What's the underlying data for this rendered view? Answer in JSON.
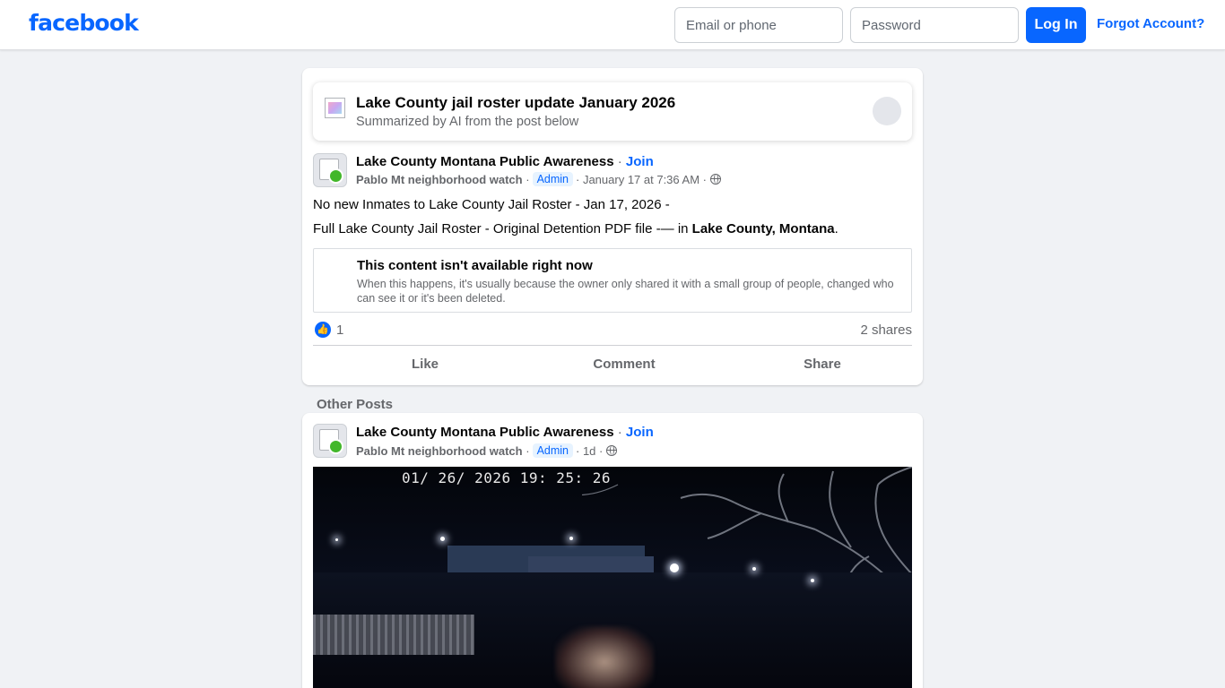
{
  "header": {
    "logo": "facebook",
    "email_placeholder": "Email or phone",
    "password_placeholder": "Password",
    "login_label": "Log In",
    "forgot_label": "Forgot Account?"
  },
  "ai_summary": {
    "title": "Lake County jail roster update January 2026",
    "subtitle": "Summarized by AI from the post below"
  },
  "post": {
    "group_name": "Lake County Montana Public Awareness",
    "separator": "·",
    "join_label": "Join",
    "author": "Pablo Mt neighborhood watch",
    "badge": "Admin",
    "timestamp": "January 17 at 7:36 AM",
    "line1": "No new Inmates to Lake County Jail Roster - Jan 17, 2026 -",
    "line2_prefix": "Full Lake County Jail Roster - Original Detention PDF file -— in ",
    "line2_bold": "Lake County, Montana",
    "line2_suffix": ".",
    "unavailable_title": "This content isn't available right now",
    "unavailable_body": "When this happens, it's usually because the owner only shared it with a small group of people, changed who can see it or it's been deleted.",
    "like_count": "1",
    "shares": "2 shares",
    "actions": {
      "like": "Like",
      "comment": "Comment",
      "share": "Share"
    }
  },
  "other_posts_label": "Other Posts",
  "post2": {
    "group_name": "Lake County Montana Public Awareness",
    "join_label": "Join",
    "author": "Pablo Mt neighborhood watch",
    "badge": "Admin",
    "timestamp": "1d",
    "image_timestamp": "01/ 26/ 2026  19: 25: 26"
  },
  "icons": {
    "like": "thumbs-up-icon",
    "globe": "globe-icon",
    "ai": "ai-summary-icon"
  },
  "colors": {
    "brand": "#0866ff",
    "background": "#f0f2f5",
    "secondary_text": "#65676b"
  }
}
